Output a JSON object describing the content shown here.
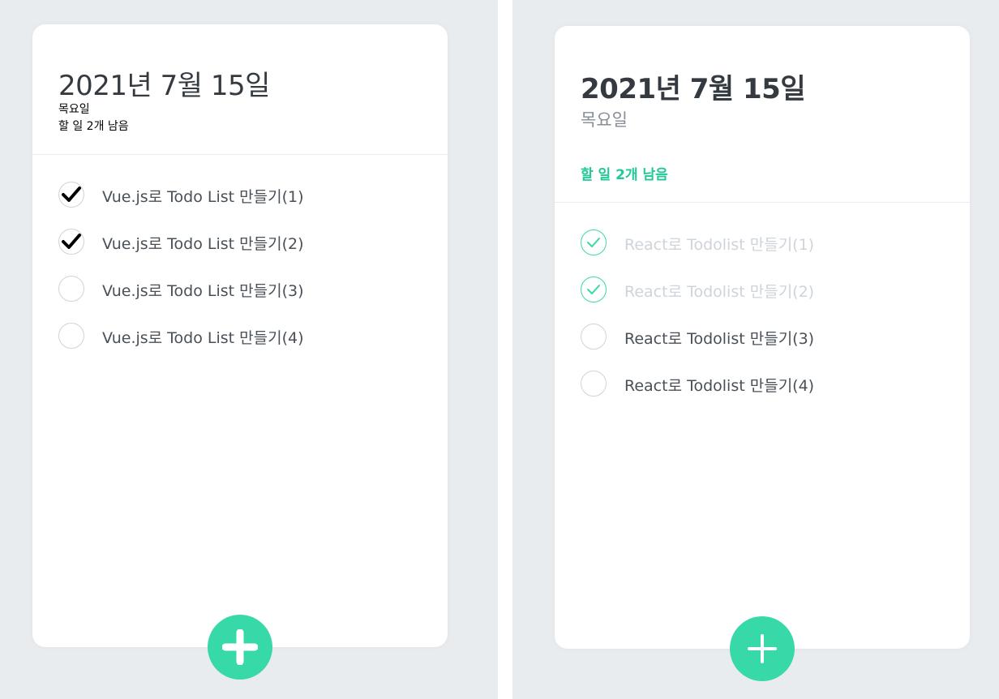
{
  "left": {
    "date": "2021년 7월 15일",
    "day": "목요일",
    "tasks_left": "할 일 2개 남음",
    "todos": [
      {
        "text": "Vue.js로 Todo List 만들기(1)",
        "done": true
      },
      {
        "text": "Vue.js로 Todo List 만들기(2)",
        "done": true
      },
      {
        "text": "Vue.js로 Todo List 만들기(3)",
        "done": false
      },
      {
        "text": "Vue.js로 Todo List 만들기(4)",
        "done": false
      }
    ],
    "add_icon": "plus-icon",
    "check_icon": "check-icon"
  },
  "right": {
    "date": "2021년 7월 15일",
    "day": "목요일",
    "tasks_left": "할 일 2개 남음",
    "todos": [
      {
        "text": "React로 Todolist 만들기(1)",
        "done": true
      },
      {
        "text": "React로 Todolist 만들기(2)",
        "done": true
      },
      {
        "text": "React로 Todolist 만들기(3)",
        "done": false
      },
      {
        "text": "React로 Todolist 만들기(4)",
        "done": false
      }
    ],
    "add_icon": "plus-icon",
    "check_icon": "check-icon"
  },
  "colors": {
    "background": "#e9ecef",
    "card": "#ffffff",
    "accent": "#38d9a9",
    "accent_text": "#20c997",
    "text": "#495057",
    "title": "#343a40",
    "muted": "#868e96",
    "done_text": "#ced4da",
    "check_dark": "#000000"
  }
}
